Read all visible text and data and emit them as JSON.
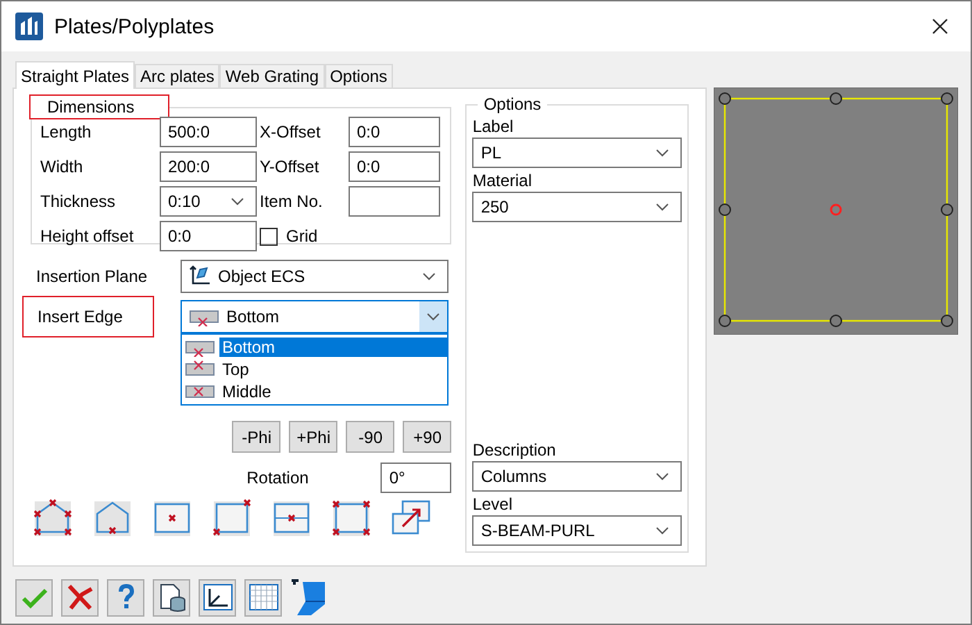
{
  "window": {
    "title": "Plates/Polyplates"
  },
  "tabs": [
    {
      "label": "Straight Plates",
      "selected": true
    },
    {
      "label": "Arc plates",
      "selected": false
    },
    {
      "label": "Web Grating",
      "selected": false
    },
    {
      "label": "Options",
      "selected": false
    }
  ],
  "dimensions": {
    "title": "Dimensions",
    "highlighted": true,
    "left": [
      {
        "label": "Length",
        "value": "500:0",
        "kind": "text"
      },
      {
        "label": "Width",
        "value": "200:0",
        "kind": "text"
      },
      {
        "label": "Thickness",
        "value": "0:10",
        "kind": "combo"
      },
      {
        "label": "Height offset",
        "value": "0:0",
        "kind": "text"
      }
    ],
    "right": [
      {
        "label": "X-Offset",
        "value": "0:0",
        "kind": "text"
      },
      {
        "label": "Y-Offset",
        "value": "0:0",
        "kind": "text"
      },
      {
        "label": "Item No.",
        "kind": "text"
      },
      {
        "label": "Grid",
        "checked": false,
        "kind": "checkbox"
      }
    ]
  },
  "insertion_plane": {
    "label": "Insertion Plane",
    "value": "Object ECS"
  },
  "insert_edge": {
    "label": "Insert Edge",
    "highlighted": true,
    "value": "Bottom",
    "open": true,
    "options": [
      {
        "label": "Bottom",
        "selected": true
      },
      {
        "label": "Top",
        "selected": false
      },
      {
        "label": "Middle",
        "selected": false
      }
    ]
  },
  "rotation_buttons": [
    "-Phi",
    "+Phi",
    "-90",
    "+90"
  ],
  "rotation": {
    "label": "Rotation",
    "value": "0°"
  },
  "options": {
    "title": "Options",
    "top": [
      {
        "label": "Label",
        "value": "PL"
      },
      {
        "label": "Material",
        "value": "250"
      }
    ],
    "bottom": [
      {
        "label": "Description",
        "value": "Columns"
      },
      {
        "label": "Level",
        "value": "S-BEAM-PURL"
      }
    ]
  }
}
